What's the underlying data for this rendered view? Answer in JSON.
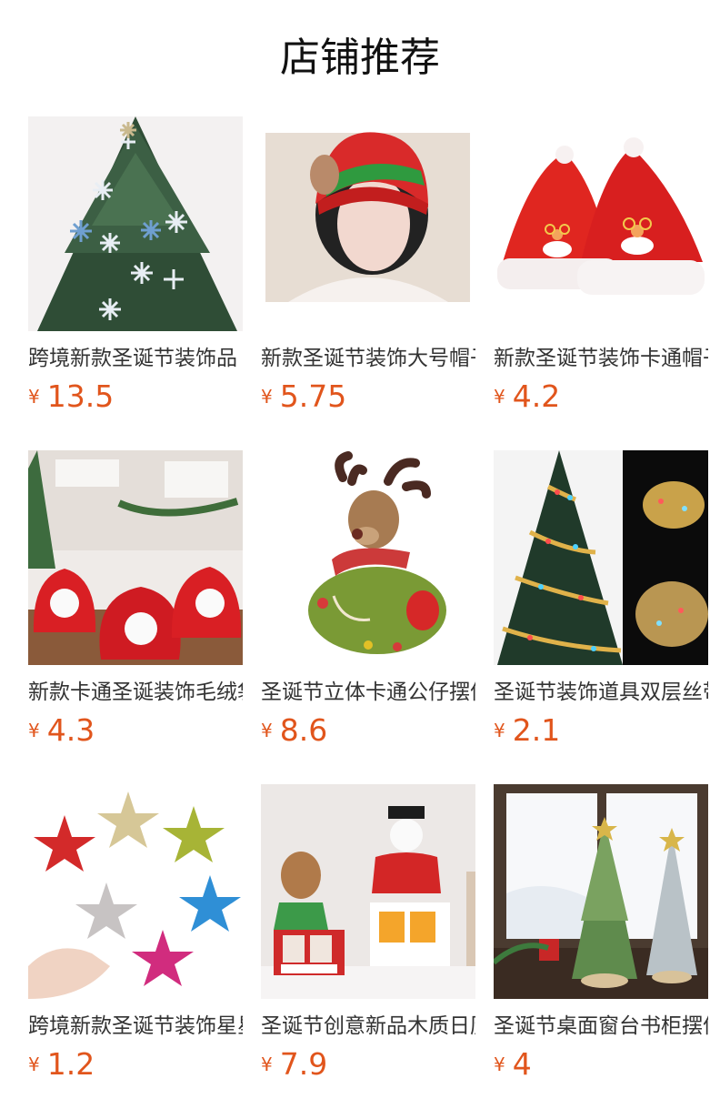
{
  "page": {
    "title": "店铺推荐"
  },
  "currency": "¥",
  "products": [
    {
      "name": "跨境新款圣诞节装饰品",
      "price": "13.5",
      "image": "christmas-tree-snowflakes"
    },
    {
      "name": "新款圣诞节装饰大号帽子",
      "price": "5.75",
      "image": "woman-elf-hat"
    },
    {
      "name": "新款圣诞节装饰卡通帽子",
      "price": "4.2",
      "image": "santa-hats"
    },
    {
      "name": "新款卡通圣诞装饰毛绒袋",
      "price": "4.3",
      "image": "santa-gift-bags"
    },
    {
      "name": "圣诞节立体卡通公仔摆件",
      "price": "8.6",
      "image": "reindeer-plush"
    },
    {
      "name": "圣诞节装饰道具双层丝带",
      "price": "2.1",
      "image": "light-ribbon-tree"
    },
    {
      "name": "跨境新款圣诞节装饰星星",
      "price": "1.2",
      "image": "glitter-stars"
    },
    {
      "name": "圣诞节创意新品木质日历",
      "price": "7.9",
      "image": "wooden-calendars"
    },
    {
      "name": "圣诞节桌面窗台书柜摆件",
      "price": "4",
      "image": "tabletop-trees"
    }
  ]
}
